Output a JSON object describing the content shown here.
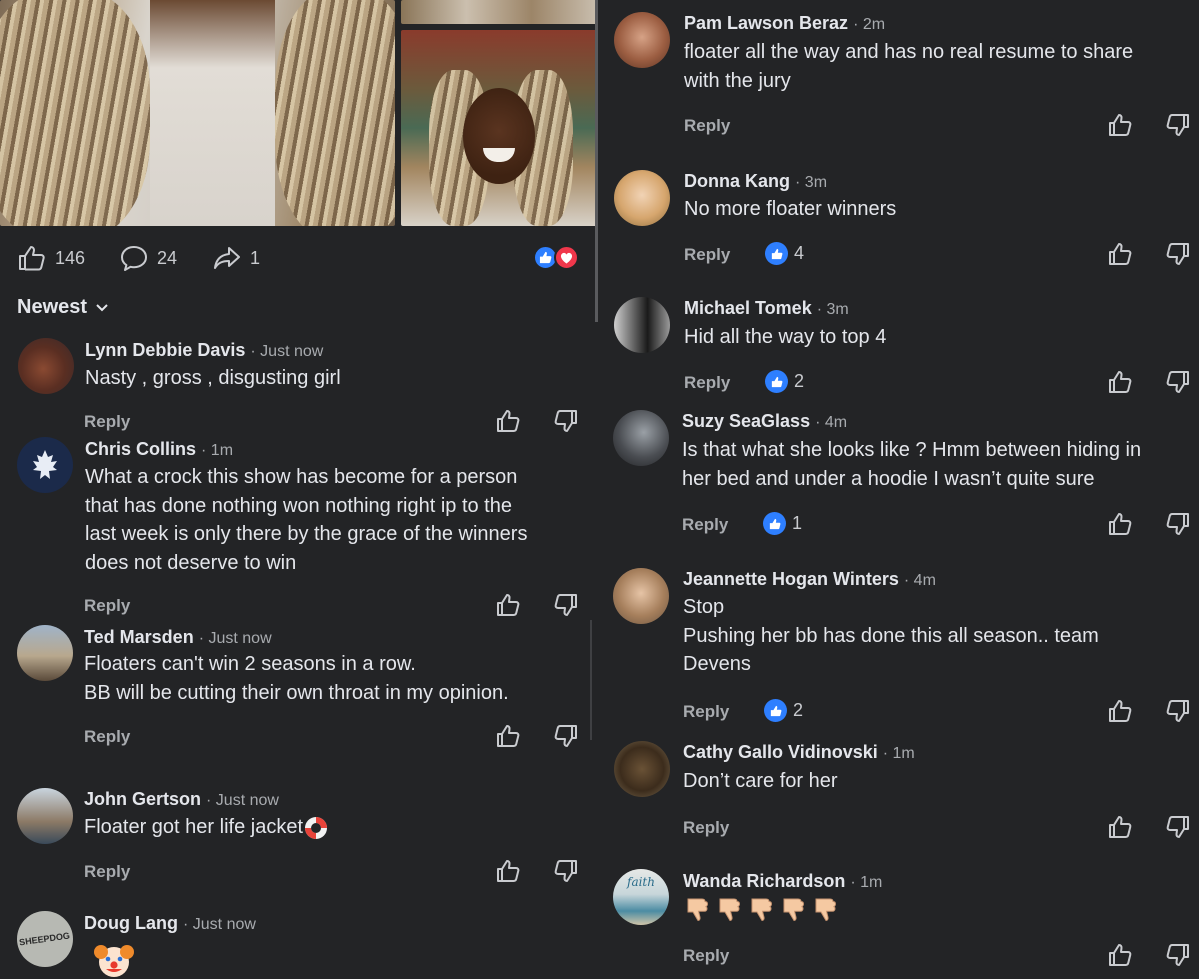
{
  "post": {
    "likes": "146",
    "comments": "24",
    "shares": "1",
    "reaction_icons": [
      "like-icon",
      "love-icon"
    ],
    "sort_label": "Newest"
  },
  "reply_label": "Reply",
  "left_comments": [
    {
      "name": "Lynn Debbie Davis",
      "time": "· Just now",
      "lines": [
        "Nasty , gross , disgusting girl"
      ]
    },
    {
      "name": "Chris Collins",
      "time": "· 1m",
      "lines": [
        "What a crock this show has become for a person",
        "that has done nothing won nothing right ip to the",
        "last week is only there by the grace of the winners",
        "does not deserve to win"
      ]
    },
    {
      "name": "Ted Marsden",
      "time": "· Just now",
      "lines": [
        "Floaters can't win 2 seasons in a row.",
        "BB will be cutting their own throat in my opinion."
      ]
    },
    {
      "name": "John Gertson",
      "time": "· Just now",
      "lines": [
        "Floater got her life jacket"
      ],
      "emoji": "ring-buoy"
    },
    {
      "name": "Doug Lang",
      "time": "· Just now",
      "lines": [],
      "emoji": "clown-face",
      "avatar_text": "SHEEPDOG"
    }
  ],
  "right_comments": [
    {
      "name": "Pam Lawson Beraz",
      "time": "· 2m",
      "lines": [
        "floater all the way and has no real resume to share",
        "with the jury"
      ],
      "likes": ""
    },
    {
      "name": "Donna Kang",
      "time": "· 3m",
      "lines": [
        "No more floater winners"
      ],
      "likes": "4"
    },
    {
      "name": "Michael Tomek",
      "time": "· 3m",
      "lines": [
        "Hid all the way to top 4"
      ],
      "likes": "2"
    },
    {
      "name": "Suzy SeaGlass",
      "time": "· 4m",
      "lines": [
        "Is that what she looks like ? Hmm between hiding in",
        "her bed and under a hoodie I wasn’t quite sure"
      ],
      "likes": "1"
    },
    {
      "name": "Jeannette Hogan Winters",
      "time": "· 4m",
      "lines": [
        "Stop",
        "Pushing her bb has done this all season.. team",
        "Devens"
      ],
      "likes": "2"
    },
    {
      "name": "Cathy Gallo Vidinovski",
      "time": "· 1m",
      "lines": [
        "Don’t care for her"
      ],
      "likes": ""
    },
    {
      "name": "Wanda Richardson",
      "time": "· 1m",
      "lines": [],
      "emoji": "thumbs-down-x5",
      "likes": "",
      "avatar_text": "faith"
    }
  ]
}
